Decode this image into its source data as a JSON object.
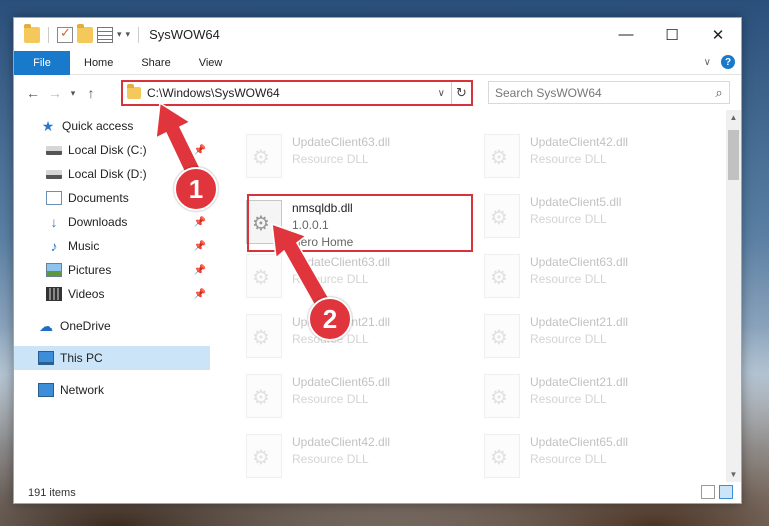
{
  "window": {
    "title": "SysWOW64",
    "controls": {
      "minimize": "—",
      "maximize": "☐",
      "close": "✕"
    }
  },
  "ribbon": {
    "tabs": [
      "File",
      "Home",
      "Share",
      "View"
    ],
    "collapse_icon": "chevron-down-icon",
    "help": "?"
  },
  "navigation": {
    "address_path": "C:\\Windows\\SysWOW64",
    "search_placeholder": "Search SysWOW64"
  },
  "sidebar": {
    "items": [
      {
        "label": "Quick access",
        "icon": "star-icon",
        "pinned": false,
        "indent": 0
      },
      {
        "label": "Local Disk (C:)",
        "icon": "drive-icon",
        "pinned": true,
        "indent": 1
      },
      {
        "label": "Local Disk (D:)",
        "icon": "drive-icon",
        "pinned": false,
        "indent": 1
      },
      {
        "label": "Documents",
        "icon": "documents-icon",
        "pinned": true,
        "indent": 1
      },
      {
        "label": "Downloads",
        "icon": "downloads-icon",
        "pinned": true,
        "indent": 1
      },
      {
        "label": "Music",
        "icon": "music-icon",
        "pinned": true,
        "indent": 1
      },
      {
        "label": "Pictures",
        "icon": "pictures-icon",
        "pinned": true,
        "indent": 1
      },
      {
        "label": "Videos",
        "icon": "videos-icon",
        "pinned": true,
        "indent": 1
      },
      {
        "label": "OneDrive",
        "icon": "onedrive-icon",
        "pinned": false,
        "indent": 0
      },
      {
        "label": "This PC",
        "icon": "this-pc-icon",
        "pinned": false,
        "indent": 0,
        "selected": true
      },
      {
        "label": "Network",
        "icon": "network-icon",
        "pinned": false,
        "indent": 0
      }
    ]
  },
  "files": {
    "highlighted": {
      "name": "nmsqldb.dll",
      "version": "1.0.0.1",
      "company": "Nero Home"
    },
    "left_column": [
      {
        "name": "UpdateClient63.dll",
        "type": "Resource DLL"
      },
      {
        "name": "UpdateClient63.dll",
        "type": "Resource DLL"
      },
      {
        "name": "UpdateClient21.dll",
        "type": "Resource DLL"
      },
      {
        "name": "UpdateClient65.dll",
        "type": "Resource DLL"
      },
      {
        "name": "UpdateClient42.dll",
        "type": "Resource DLL"
      }
    ],
    "right_column": [
      {
        "name": "UpdateClient42.dll",
        "type": "Resource DLL"
      },
      {
        "name": "UpdateClient5.dll",
        "type": "Resource DLL"
      },
      {
        "name": "UpdateClient63.dll",
        "type": "Resource DLL"
      },
      {
        "name": "UpdateClient21.dll",
        "type": "Resource DLL"
      },
      {
        "name": "UpdateClient21.dll",
        "type": "Resource DLL"
      },
      {
        "name": "UpdateClient65.dll",
        "type": "Resource DLL"
      }
    ]
  },
  "status": {
    "item_count": "191 items"
  },
  "annotations": {
    "step1": "1",
    "step2": "2",
    "color": "#e0353d"
  }
}
